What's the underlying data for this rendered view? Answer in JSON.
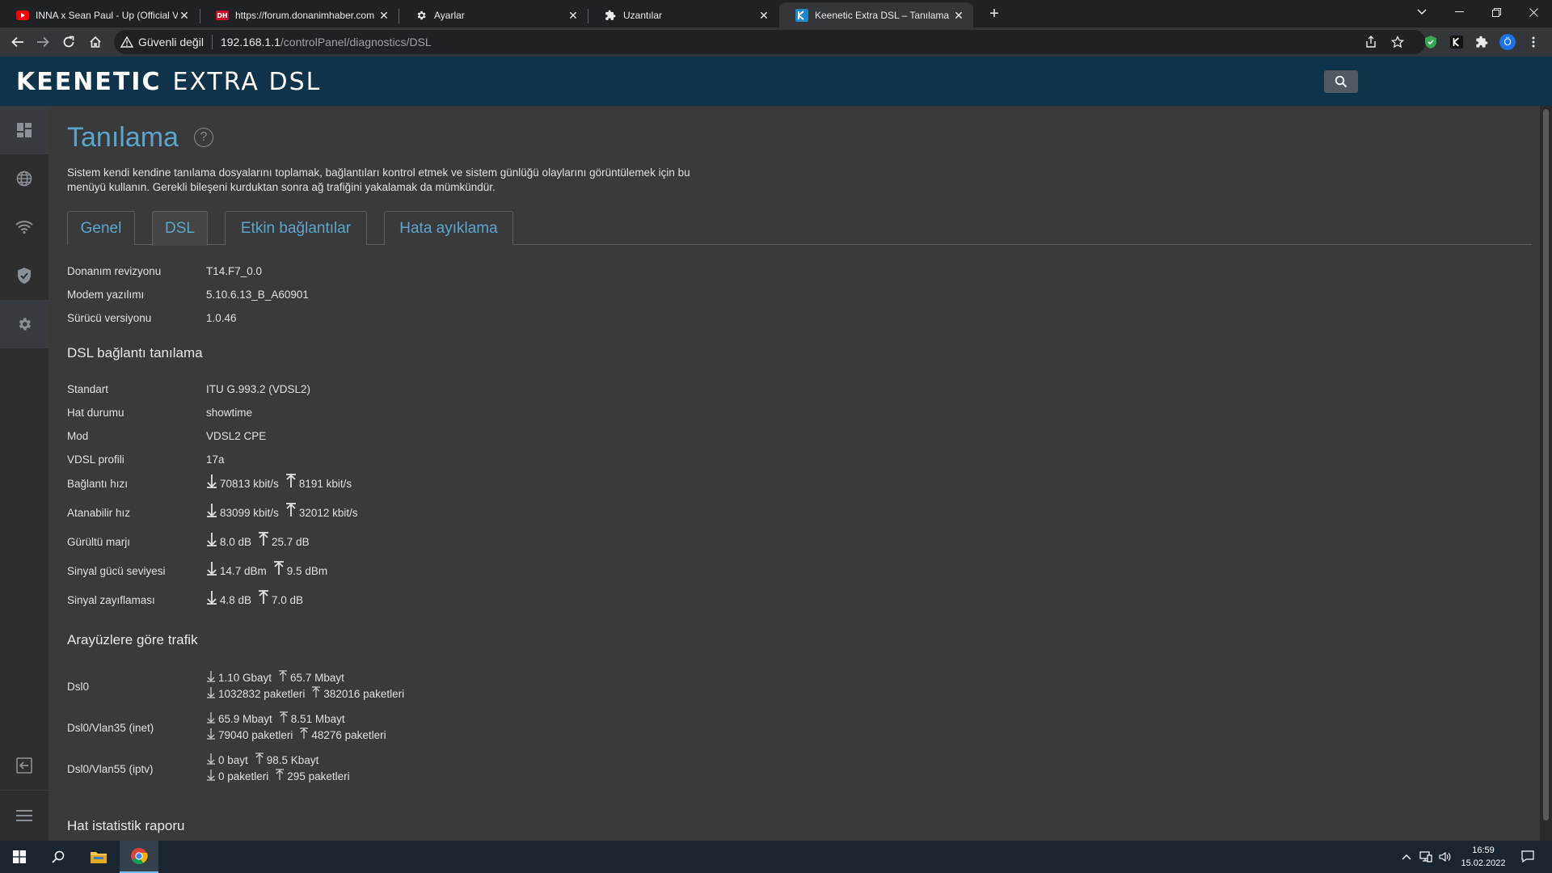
{
  "browser": {
    "tabs": [
      {
        "title": "INNA x Sean Paul - Up (Official V",
        "icon": "youtube-icon",
        "active": false
      },
      {
        "title": "https://forum.donanimhaber.com",
        "icon": "donanimhaber-icon",
        "active": false
      },
      {
        "title": "Ayarlar",
        "icon": "gear-icon",
        "active": false
      },
      {
        "title": "Uzantılar",
        "icon": "puzzle-icon",
        "active": false
      },
      {
        "title": "Keenetic Extra DSL – Tanılama",
        "icon": "keenetic-icon",
        "active": true
      }
    ],
    "address": {
      "security_label": "Güvenli değil",
      "host": "192.168.1.1",
      "path": "/controlPanel/diagnostics/DSL"
    },
    "profile_initial": "Ö"
  },
  "app": {
    "brand": "KEENETIC",
    "model": "EXTRA DSL"
  },
  "page": {
    "title": "Tanılama",
    "help": "?",
    "description": "Sistem kendi kendine tanılama dosyalarını toplamak, bağlantıları kontrol etmek ve sistem günlüğü olaylarını görüntülemek için bu menüyü kullanın. Gerekli bileşeni kurduktan sonra ağ trafiğini yakalamak da mümkündür.",
    "tabs": [
      {
        "label": "Genel",
        "active": false
      },
      {
        "label": "DSL",
        "active": true
      },
      {
        "label": "Etkin bağlantılar",
        "active": false
      },
      {
        "label": "Hata ayıklama",
        "active": false
      }
    ]
  },
  "hardware": [
    {
      "key": "Donanım revizyonu",
      "value": "T14.F7_0.0"
    },
    {
      "key": "Modem yazılımı",
      "value": "5.10.6.13_B_A60901"
    },
    {
      "key": "Sürücü versiyonu",
      "value": "1.0.46"
    }
  ],
  "dsl_section_title": "DSL bağlantı tanılama",
  "dsl_info": [
    {
      "key": "Standart",
      "value": "ITU G.993.2 (VDSL2)"
    },
    {
      "key": "Hat durumu",
      "value": "showtime"
    },
    {
      "key": "Mod",
      "value": "VDSL2 CPE"
    },
    {
      "key": "VDSL profili",
      "value": "17a"
    }
  ],
  "dsl_metrics": [
    {
      "key": "Bağlantı hızı",
      "down": "70813 kbit/s",
      "up": "8191 kbit/s"
    },
    {
      "key": "Atanabilir hız",
      "down": "83099 kbit/s",
      "up": "32012 kbit/s"
    },
    {
      "key": "Gürültü marjı",
      "down": "8.0 dB",
      "up": "25.7 dB"
    },
    {
      "key": "Sinyal gücü seviyesi",
      "down": "14.7 dBm",
      "up": "9.5 dBm"
    },
    {
      "key": "Sinyal zayıflaması",
      "down": "4.8 dB",
      "up": "7.0 dB"
    }
  ],
  "traffic_section_title": "Arayüzlere göre trafik",
  "traffic": [
    {
      "name": "Dsl0",
      "down_bytes": "1.10 Gbayt",
      "up_bytes": "65.7 Mbayt",
      "down_packets": "1032832 paketleri",
      "up_packets": "382016 paketleri"
    },
    {
      "name": "Dsl0/Vlan35 (inet)",
      "down_bytes": "65.9 Mbayt",
      "up_bytes": "8.51 Mbayt",
      "down_packets": "79040 paketleri",
      "up_packets": "48276 paketleri"
    },
    {
      "name": "Dsl0/Vlan55 (iptv)",
      "down_bytes": "0 bayt",
      "up_bytes": "98.5 Kbayt",
      "down_packets": "0 paketleri",
      "up_packets": "295 paketleri"
    }
  ],
  "report_section_title": "Hat istatistik raporu",
  "taskbar": {
    "time": "16:59",
    "date": "15.02.2022"
  },
  "colors": {
    "header_bg": "#0f3349",
    "accent": "#5aa6cc",
    "content_bg": "#3a3a3a",
    "sidebar_bg": "#2e2e2e"
  }
}
